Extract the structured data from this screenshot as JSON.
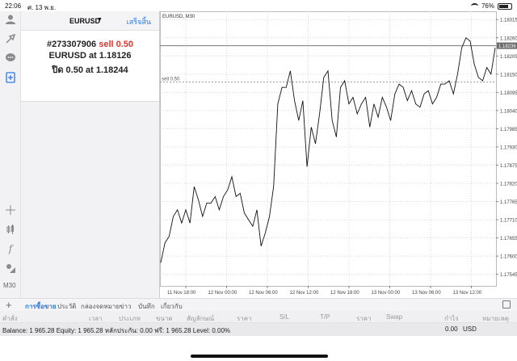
{
  "status_bar": {
    "time": "22:06",
    "date": "ศ. 13 พ.ย.",
    "battery": "76%"
  },
  "left_toolbar": {
    "timeframe": "M30"
  },
  "order_panel": {
    "symbol": "EURUSD",
    "done_label": "เสร็จสิ้น",
    "order_id": "#273307906",
    "order_action": "sell 0.50",
    "open_line": "EURUSD at 1.18126",
    "close_line": "ปิด 0.50 at 1.18244"
  },
  "chart": {
    "title": "EURUSD, M30",
    "position_label": "sell 0.50",
    "current_price": "1.18236",
    "price_ticks": [
      "1.18315",
      "1.18260",
      "1.18205",
      "1.18150",
      "1.18095",
      "1.18040",
      "1.17985",
      "1.17930",
      "1.17875",
      "1.17820",
      "1.17765",
      "1.17710",
      "1.17655",
      "1.17600",
      "1.17545"
    ],
    "time_ticks": [
      "11 Nov 18:00",
      "12 Nov 00:00",
      "12 Nov 06:00",
      "12 Nov 12:00",
      "12 Nov 18:00",
      "13 Nov 00:00",
      "13 Nov 06:00",
      "13 Nov 12:00"
    ]
  },
  "chart_data": {
    "type": "line",
    "title": "EURUSD, M30",
    "xlabel": "",
    "ylabel": "",
    "ylim": [
      1.1751,
      1.1834
    ],
    "grid": true,
    "x": [
      0,
      1,
      2,
      3,
      4,
      5,
      6,
      7,
      8,
      9,
      10,
      11,
      12,
      13,
      14,
      15,
      16,
      17,
      18,
      19,
      20,
      21,
      22,
      23,
      24,
      25,
      26,
      27,
      28,
      29,
      30,
      31,
      32,
      33,
      34,
      35,
      36,
      37,
      38,
      39,
      40,
      41,
      42,
      43,
      44,
      45,
      46,
      47,
      48,
      49,
      50,
      51,
      52,
      53,
      54,
      55,
      56,
      57,
      58,
      59,
      60,
      61,
      62,
      63,
      64,
      65,
      66,
      67,
      68,
      69,
      70,
      71,
      72,
      73,
      74,
      75,
      76,
      77,
      78,
      79,
      80,
      81,
      82,
      83,
      84,
      85,
      86,
      87,
      88,
      89,
      90,
      91,
      92,
      93,
      94,
      95,
      96,
      97,
      98,
      99,
      100
    ],
    "series": [
      {
        "values": [
          1.1758,
          1.1764,
          1.1766,
          1.1772,
          1.1774,
          1.177,
          1.1774,
          1.177,
          1.1781,
          1.1777,
          1.1772,
          1.1776,
          1.1776,
          1.1778,
          1.1774,
          1.1778,
          1.178,
          1.1784,
          1.1778,
          1.1779,
          1.1773,
          1.1771,
          1.1769,
          1.1774,
          1.1763,
          1.1767,
          1.1772,
          1.1781,
          1.1806,
          1.1811,
          1.1811,
          1.1816,
          1.1807,
          1.1801,
          1.1807,
          1.1787,
          1.1799,
          1.1794,
          1.1803,
          1.1814,
          1.1816,
          1.1801,
          1.1796,
          1.1811,
          1.1813,
          1.1806,
          1.1808,
          1.1803,
          1.1806,
          1.1808,
          1.1799,
          1.1806,
          1.1802,
          1.1808,
          1.1805,
          1.1801,
          1.1809,
          1.1812,
          1.1811,
          1.1807,
          1.181,
          1.1806,
          1.1805,
          1.1809,
          1.181,
          1.1806,
          1.1808,
          1.1812,
          1.1812,
          1.1813,
          1.1809,
          1.1815,
          1.1823,
          1.1826,
          1.1825,
          1.1818,
          1.1814,
          1.1813,
          1.1817,
          1.1815,
          1.1823
        ],
        "color": "#111111"
      }
    ],
    "horizontal_lines": [
      {
        "label": "sell 0.50",
        "value": 1.18126,
        "style": "dashed"
      },
      {
        "label": "1.18236",
        "value": 1.18236,
        "style": "solid"
      }
    ]
  },
  "bottom_tabs": [
    "การซื้อขาย",
    "ประวัติ",
    "กล่องจดหมาย",
    "ข่าว",
    "บันทึก",
    "เกี่ยวกับ"
  ],
  "columns": [
    "คำสั่ง",
    "เวลา",
    "ประเภท",
    "ขนาด",
    "สัญลักษณ์",
    "ราคา",
    "S/L",
    "T/P",
    "ราคา",
    "Swap",
    "กำไร",
    "หมายเหตุ"
  ],
  "balance": {
    "text": "Balance: 1 965.28 Equity: 1 965.28 หลักประกัน: 0.00 ฟรี: 1 965.28 Level: 0.00%",
    "profit": "0.00",
    "currency": "USD"
  },
  "colors": {
    "accent": "#2a7ae2",
    "sell_red": "#e0342c"
  }
}
